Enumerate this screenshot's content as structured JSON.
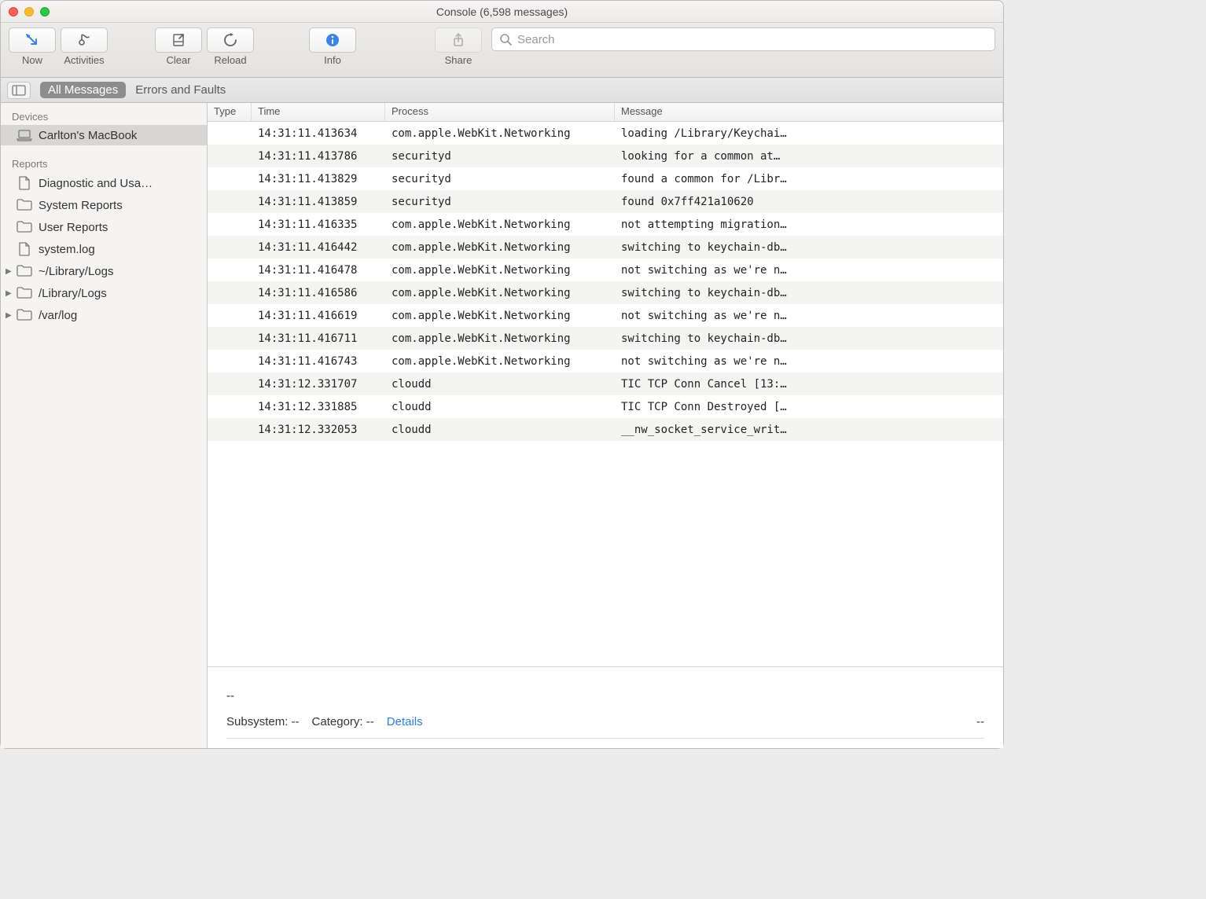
{
  "window": {
    "title": "Console (6,598 messages)"
  },
  "toolbar": {
    "now": "Now",
    "activities": "Activities",
    "clear": "Clear",
    "reload": "Reload",
    "info": "Info",
    "share": "Share",
    "search_placeholder": "Search"
  },
  "filterbar": {
    "all_messages": "All Messages",
    "errors_faults": "Errors and Faults"
  },
  "sidebar": {
    "devices_header": "Devices",
    "device_name": "Carlton's MacBook",
    "reports_header": "Reports",
    "items": [
      {
        "label": "Diagnostic and Usa…",
        "icon": "file"
      },
      {
        "label": "System Reports",
        "icon": "folder"
      },
      {
        "label": "User Reports",
        "icon": "folder"
      },
      {
        "label": "system.log",
        "icon": "file"
      },
      {
        "label": "~/Library/Logs",
        "icon": "folder",
        "expandable": true
      },
      {
        "label": "/Library/Logs",
        "icon": "folder",
        "expandable": true
      },
      {
        "label": "/var/log",
        "icon": "folder",
        "expandable": true
      }
    ]
  },
  "columns": {
    "type": "Type",
    "time": "Time",
    "process": "Process",
    "message": "Message"
  },
  "rows": [
    {
      "time": "14:31:11.413634",
      "process": "com.apple.WebKit.Networking",
      "message": "loading /Library/Keychai…"
    },
    {
      "time": "14:31:11.413786",
      "process": "securityd",
      "message": "looking for a common at…"
    },
    {
      "time": "14:31:11.413829",
      "process": "securityd",
      "message": "found a common for /Libr…"
    },
    {
      "time": "14:31:11.413859",
      "process": "securityd",
      "message": "found 0x7ff421a10620"
    },
    {
      "time": "14:31:11.416335",
      "process": "com.apple.WebKit.Networking",
      "message": "not attempting migration…"
    },
    {
      "time": "14:31:11.416442",
      "process": "com.apple.WebKit.Networking",
      "message": "switching to keychain-db…"
    },
    {
      "time": "14:31:11.416478",
      "process": "com.apple.WebKit.Networking",
      "message": "not switching as we're n…"
    },
    {
      "time": "14:31:11.416586",
      "process": "com.apple.WebKit.Networking",
      "message": "switching to keychain-db…"
    },
    {
      "time": "14:31:11.416619",
      "process": "com.apple.WebKit.Networking",
      "message": "not switching as we're n…"
    },
    {
      "time": "14:31:11.416711",
      "process": "com.apple.WebKit.Networking",
      "message": "switching to keychain-db…"
    },
    {
      "time": "14:31:11.416743",
      "process": "com.apple.WebKit.Networking",
      "message": "not switching as we're n…"
    },
    {
      "time": "14:31:12.331707",
      "process": "cloudd",
      "message": "TIC TCP Conn Cancel [13:…"
    },
    {
      "time": "14:31:12.331885",
      "process": "cloudd",
      "message": "TIC TCP Conn Destroyed […"
    },
    {
      "time": "14:31:12.332053",
      "process": "cloudd",
      "message": "__nw_socket_service_writ…"
    }
  ],
  "detail": {
    "dash": "--",
    "subsystem_label": "Subsystem:",
    "subsystem_value": "--",
    "category_label": "Category:",
    "category_value": "--",
    "details_link": "Details",
    "right_dash": "--"
  }
}
